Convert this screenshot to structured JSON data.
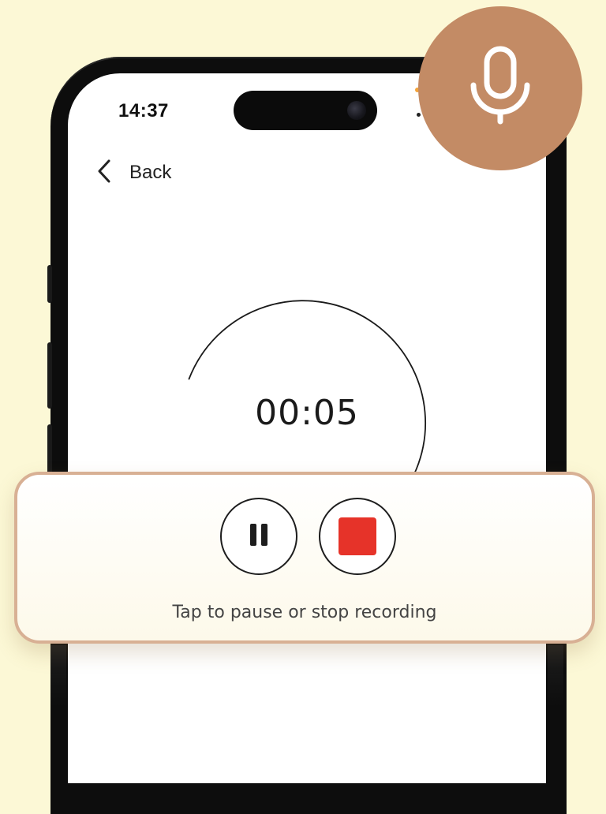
{
  "status_bar": {
    "time": "14:37"
  },
  "nav": {
    "back_label": "Back"
  },
  "recorder": {
    "elapsed": "00:05",
    "hint": "Tap to pause or stop recording"
  },
  "icons": {
    "back": "chevron-left-icon",
    "mic": "microphone-icon",
    "pause": "pause-icon",
    "stop": "stop-icon"
  },
  "colors": {
    "background": "#fcf8d6",
    "mic_badge": "#c38b65",
    "panel_border": "#d8b094",
    "stop": "#e63329"
  }
}
